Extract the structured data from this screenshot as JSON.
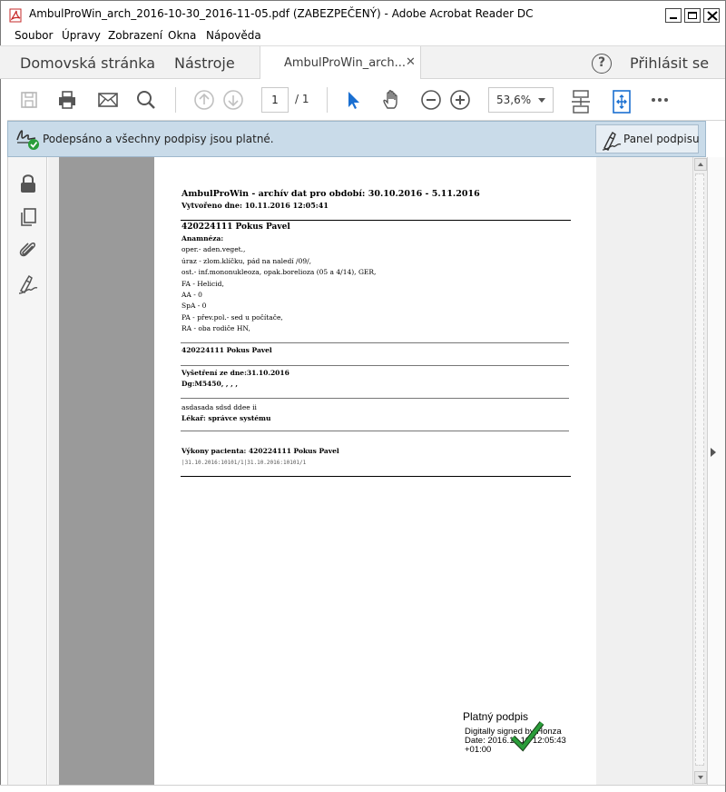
{
  "window": {
    "title": "AmbulProWin_arch_2016-10-30_2016-11-05.pdf (ZABEZPEČENÝ) - Adobe Acrobat Reader DC"
  },
  "menu": [
    "Soubor",
    "Úpravy",
    "Zobrazení",
    "Okna",
    "Nápověda"
  ],
  "tabs": {
    "home": "Domovská stránka",
    "tools": "Nástroje",
    "document": "AmbulProWin_arch...",
    "signin": "Přihlásit se"
  },
  "toolbar": {
    "page_current": "1",
    "page_total": "/ 1",
    "zoom": "53,6%"
  },
  "signature_bar": {
    "message": "Podepsáno a všechny podpisy jsou platné.",
    "panel_button": "Panel podpisu",
    "accent": "#2a9d3a"
  },
  "document": {
    "title": "AmbulProWin - archív dat pro období: 30.10.2016 - 5.11.2016",
    "created": "Vytvořeno dne: 10.11.2016 12:05:41",
    "patient_header": "420224111  Pokus Pavel",
    "anamnesis_label": "Anamnéza:",
    "anamnesis_lines": [
      "oper.- aden.veget.,",
      "úraz - zlom.klíčku, pád na naledí /09/,",
      "ost.- inf.mononukleoza, opak.borelioza (05 a 4/14), GER,",
      "FA - Helicid,",
      "AA - 0",
      "SpA - 0",
      "PA - přev.pol.- sed u počítače,",
      "RA - oba rodiče HN,"
    ],
    "patient_header_2": "420224111  Pokus Pavel",
    "exam_date": "Vyšetření ze dne:31.10.2016",
    "diagnosis": "Dg:M5450,      ,      ,      ,",
    "note": "asdasada sdsd ddee  ii",
    "doctor": "Lékař: správce systému",
    "services": "Výkony pacienta: 420224111  Pokus Pavel",
    "services_code": "|31.10.2016:10101/1|31.10.2016:10101/1"
  },
  "signature": {
    "heading": "Platný podpis",
    "line1": "Digitally signed by Honza",
    "line2": "Date: 2016.11.10 12:05:43",
    "line3": "+01:00"
  }
}
